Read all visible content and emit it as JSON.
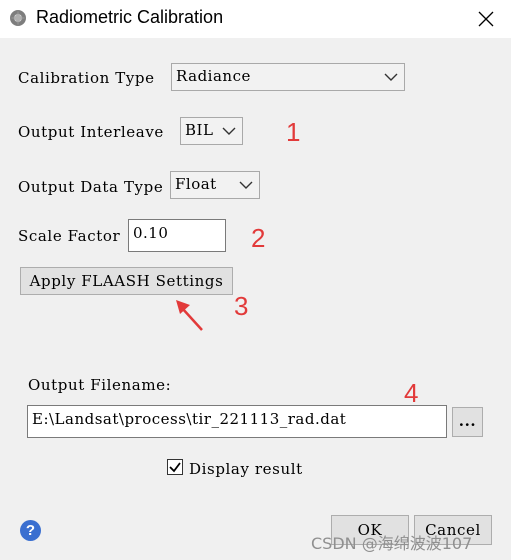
{
  "window": {
    "title": "Radiometric Calibration"
  },
  "form": {
    "calibration_type_label": "Calibration Type",
    "calibration_type_value": "Radiance",
    "output_interleave_label": "Output Interleave",
    "output_interleave_value": "BIL",
    "output_data_type_label": "Output Data Type",
    "output_data_type_value": "Float",
    "scale_factor_label": "Scale Factor",
    "scale_factor_value": "0.10",
    "apply_flaash_label": "Apply FLAASH Settings",
    "output_filename_label": "Output Filename:",
    "output_filename_value": "E:\\Landsat\\process\\tir_221113_rad.dat",
    "browse_label": "...",
    "display_result_label": "Display result",
    "display_result_checked": true
  },
  "footer": {
    "ok_label": "OK",
    "cancel_label": "Cancel",
    "help_glyph": "?"
  },
  "annotations": [
    "1",
    "2",
    "3",
    "4"
  ],
  "watermark": "CSDN @海绵波波107",
  "colors": {
    "annotation": "#e23a3a",
    "dialog_bg": "#f0f0f0",
    "help_icon": "#3a6fd0"
  }
}
